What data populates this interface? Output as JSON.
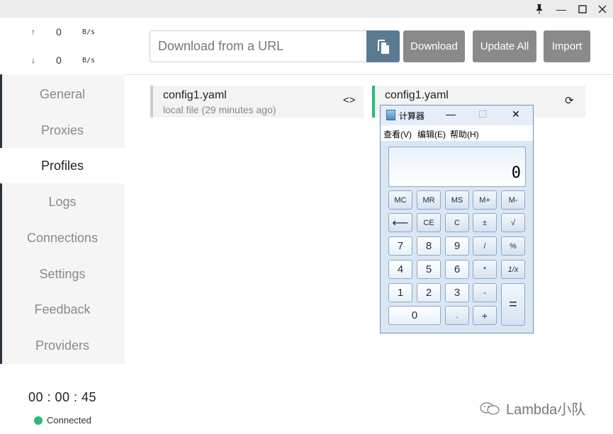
{
  "window": {
    "pin_icon": "pin-icon",
    "min_glyph": "—",
    "max_glyph": "☐",
    "close_glyph": "✕"
  },
  "traffic": {
    "up_arrow": "↑",
    "up_value": "0",
    "up_unit": "B/s",
    "down_arrow": "↓",
    "down_value": "0",
    "down_unit": "B/s"
  },
  "sidebar": {
    "items": [
      {
        "label": "General"
      },
      {
        "label": "Proxies"
      },
      {
        "label": "Profiles"
      },
      {
        "label": "Logs"
      },
      {
        "label": "Connections"
      },
      {
        "label": "Settings"
      },
      {
        "label": "Feedback"
      },
      {
        "label": "Providers"
      }
    ],
    "active": "Profiles",
    "timer": "00 : 00 : 45",
    "status": "Connected",
    "status_color": "#2fb87c"
  },
  "toolbar": {
    "url_placeholder": "Download from a URL",
    "download_label": "Download",
    "update_all_label": "Update All",
    "import_label": "Import",
    "button_color": "#8a8a8a",
    "paste_color": "#5a7a91"
  },
  "profiles": [
    {
      "name": "config1.yaml",
      "subtitle": "local file (29 minutes ago)",
      "action_icon": "code-icon",
      "action_glyph": "<>",
      "selected": false
    },
    {
      "name": "config1.yaml",
      "action_icon": "refresh-icon",
      "action_glyph": "⟳",
      "selected": true,
      "accent": "#2fb87c"
    }
  ],
  "calculator": {
    "title": "计算器",
    "menu": [
      "查看(V)",
      "编辑(E)",
      "帮助(H)"
    ],
    "display": "0",
    "memory_keys": [
      "MC",
      "MR",
      "MS",
      "M+",
      "M-"
    ],
    "row2": [
      "⟵",
      "CE",
      "C",
      "±",
      "√"
    ],
    "row3": [
      "7",
      "8",
      "9",
      "/",
      "%"
    ],
    "row4": [
      "4",
      "5",
      "6",
      "*",
      "1/x"
    ],
    "row5": [
      "1",
      "2",
      "3",
      "-"
    ],
    "row6": [
      "0",
      ".",
      "+"
    ],
    "equals": "="
  },
  "watermark": {
    "text": "Lambda小队",
    "icon": "wechat-icon"
  }
}
